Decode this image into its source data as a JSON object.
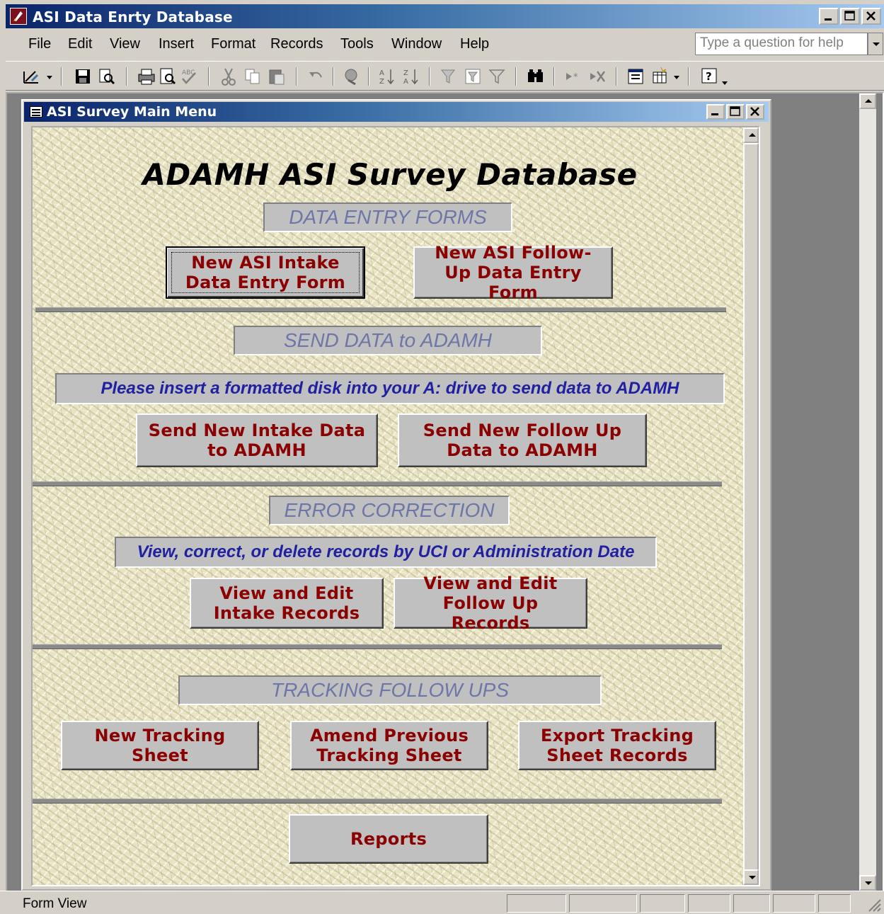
{
  "app": {
    "title": "ASI Data Enrty Database",
    "menu": [
      "File",
      "Edit",
      "View",
      "Insert",
      "Format",
      "Records",
      "Tools",
      "Window",
      "Help"
    ],
    "help_placeholder": "Type a question for help"
  },
  "child_window": {
    "title": "ASI Survey Main Menu"
  },
  "form": {
    "main_title": "ADAMH ASI Survey Database",
    "sections": {
      "data_entry": {
        "label": "DATA ENTRY FORMS",
        "buttons": [
          "New ASI Intake Data Entry Form",
          "New ASI Follow-Up Data Entry Form"
        ]
      },
      "send_data": {
        "label": "SEND DATA to ADAMH",
        "instruction": "Please insert a formatted disk into your A: drive to send data to ADAMH",
        "buttons": [
          "Send New Intake Data to ADAMH",
          "Send New Follow Up Data to ADAMH"
        ]
      },
      "error_correction": {
        "label": "ERROR CORRECTION",
        "instruction": "View, correct, or delete records by UCI or Administration Date",
        "buttons": [
          "View and Edit Intake Records",
          "View and Edit Follow Up Records"
        ]
      },
      "tracking": {
        "label": "TRACKING FOLLOW UPS",
        "buttons": [
          "New Tracking Sheet",
          "Amend Previous Tracking Sheet",
          "Export Tracking Sheet Records"
        ]
      },
      "reports": {
        "button": "Reports"
      }
    }
  },
  "status": {
    "text": "Form View"
  },
  "colors": {
    "title_gradient_start": "#0a246a",
    "title_gradient_end": "#a6caf0",
    "button_text": "#8b0000",
    "section_label_text": "#6e76a8",
    "instruction_text": "#2020a0"
  }
}
